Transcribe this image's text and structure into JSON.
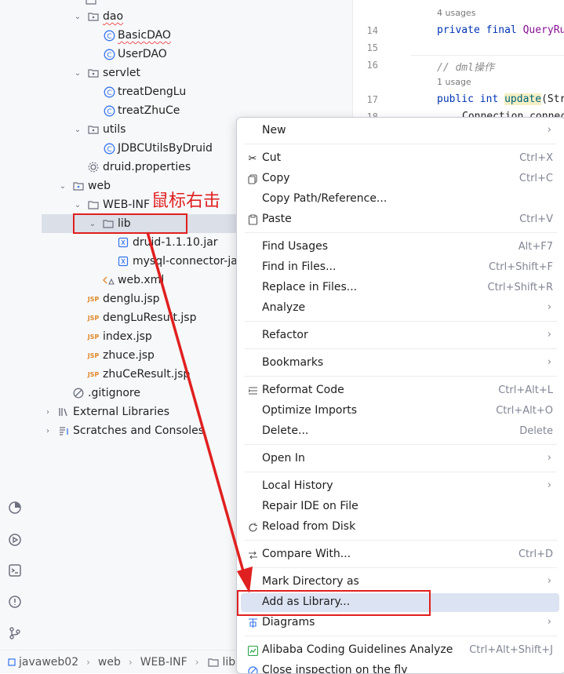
{
  "tree": {
    "folders": [
      "dao",
      "servlet",
      "utils",
      "web",
      "WEB-INF",
      "lib"
    ],
    "files": [
      "BasicDAO",
      "UserDAO",
      "treatDengLu",
      "treatZhuCe",
      "JDBCUtilsByDruid",
      "druid.properties",
      "druid-1.1.10.jar",
      "mysql-connector-jav",
      "web.xml",
      "denglu.jsp",
      "dengLuResult.jsp",
      "index.jsp",
      "zhuce.jsp",
      "zhuCeResult.jsp",
      ".gitignore"
    ],
    "external_libraries": "External Libraries",
    "scratches": "Scratches and Consoles"
  },
  "annotation": "鼠标右击",
  "editor": {
    "lines": [
      "14",
      "15",
      "16",
      "17",
      "18"
    ],
    "hint1": "4 usages",
    "code14a": "private final ",
    "code14b": "QueryRu",
    "comment16": "// dml操作",
    "hint2": "1 usage",
    "code17a": "public int ",
    "code17b": "update",
    "code17c": "(Str",
    "code18": "Connection connec"
  },
  "menu": {
    "new": "New",
    "cut": "Cut",
    "cut_sc": "Ctrl+X",
    "copy": "Copy",
    "copy_sc": "Ctrl+C",
    "copy_path": "Copy Path/Reference...",
    "paste": "Paste",
    "paste_sc": "Ctrl+V",
    "find_usages": "Find Usages",
    "find_usages_sc": "Alt+F7",
    "find_in_files": "Find in Files...",
    "find_in_files_sc": "Ctrl+Shift+F",
    "replace_in_files": "Replace in Files...",
    "replace_in_files_sc": "Ctrl+Shift+R",
    "analyze": "Analyze",
    "refactor": "Refactor",
    "bookmarks": "Bookmarks",
    "reformat": "Reformat Code",
    "reformat_sc": "Ctrl+Alt+L",
    "optimize": "Optimize Imports",
    "optimize_sc": "Ctrl+Alt+O",
    "delete": "Delete...",
    "delete_sc": "Delete",
    "open_in": "Open In",
    "local_history": "Local History",
    "repair": "Repair IDE on File",
    "reload": "Reload from Disk",
    "compare": "Compare With...",
    "compare_sc": "Ctrl+D",
    "mark_dir": "Mark Directory as",
    "add_library": "Add as Library...",
    "diagrams": "Diagrams",
    "alibaba": "Alibaba Coding Guidelines Analyze",
    "alibaba_sc": "Ctrl+Alt+Shift+J",
    "close_inspection": "Close inspection on the fly"
  },
  "breadcrumb": [
    "javaweb02",
    "web",
    "WEB-INF",
    "lib"
  ],
  "colors": {
    "accent": "#e02020",
    "highlight": "#dce3f2",
    "selection": "#dbdfe7",
    "keyword": "#0033b3",
    "method": "#00627a"
  }
}
